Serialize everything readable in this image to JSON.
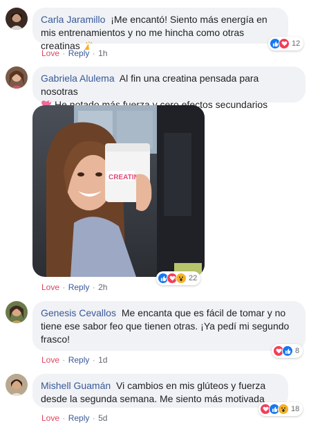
{
  "comments": [
    {
      "author": "Carla Jaramillo",
      "text": "¡Me encantó! Siento más energía en mis entrenamientos y no me hincha como otras creatinas",
      "love_label": "Love",
      "reply_label": "Reply",
      "time": "1h",
      "reaction_count": "12",
      "reactions": [
        "like-icon",
        "love-icon"
      ]
    },
    {
      "author": "Gabriela Alulema",
      "text_line1": "Al fin una creatina pensada para nosotras",
      "text_line2": "He notado más fuerza y cero efectos secundarios",
      "love_label": "Love",
      "reply_label": "Reply",
      "time": "2h",
      "reaction_count": "22",
      "reactions": [
        "like-icon",
        "love-icon",
        "wow-icon"
      ],
      "photo_product_label": "CREATINE"
    },
    {
      "author": "Genesis Cevallos",
      "text": "Me encanta que es fácil de tomar y no tiene ese sabor feo que tienen otras. ¡Ya pedí mi segundo frasco!",
      "love_label": "Love",
      "reply_label": "Reply",
      "time": "1d",
      "reaction_count": "8",
      "reactions": [
        "love-icon",
        "like-icon"
      ]
    },
    {
      "author": "Mishell Guamán",
      "text": "Vi cambios en mis glúteos y fuerza desde la segunda semana. Me siento más motivada que nunca",
      "love_label": "Love",
      "reply_label": "Reply",
      "time": "5d",
      "reaction_count": "18",
      "reactions": [
        "love-icon",
        "like-icon",
        "wow-icon"
      ]
    }
  ],
  "colors": {
    "author": "#385898",
    "love": "#e0435e",
    "bubble": "#f0f2f5",
    "like": "#1877f2",
    "heart": "#f33e58",
    "wow": "#f7b125"
  },
  "separator": "·"
}
